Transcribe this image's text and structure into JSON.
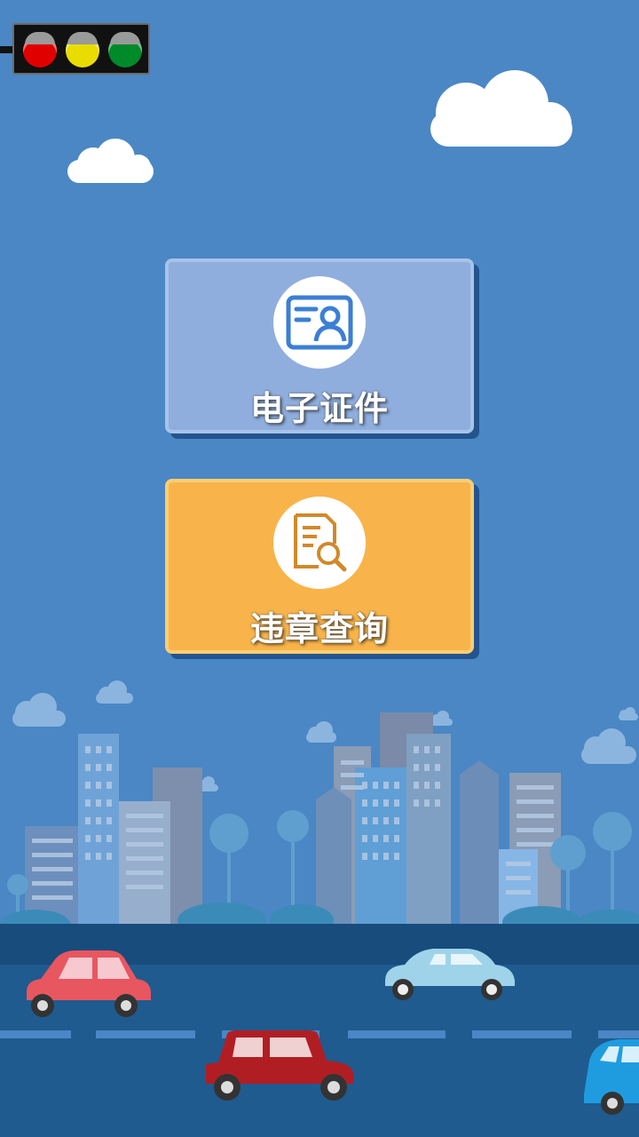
{
  "menu": {
    "items": [
      {
        "label": "电子证件",
        "icon": "id-card-icon",
        "color": "#8faedd"
      },
      {
        "label": "违章查询",
        "icon": "document-search-icon",
        "color": "#f8b44a"
      }
    ]
  },
  "scene": {
    "traffic_light": [
      "#e00000",
      "#e8dc00",
      "#008a2a"
    ],
    "background_color": "#4a87c4"
  }
}
